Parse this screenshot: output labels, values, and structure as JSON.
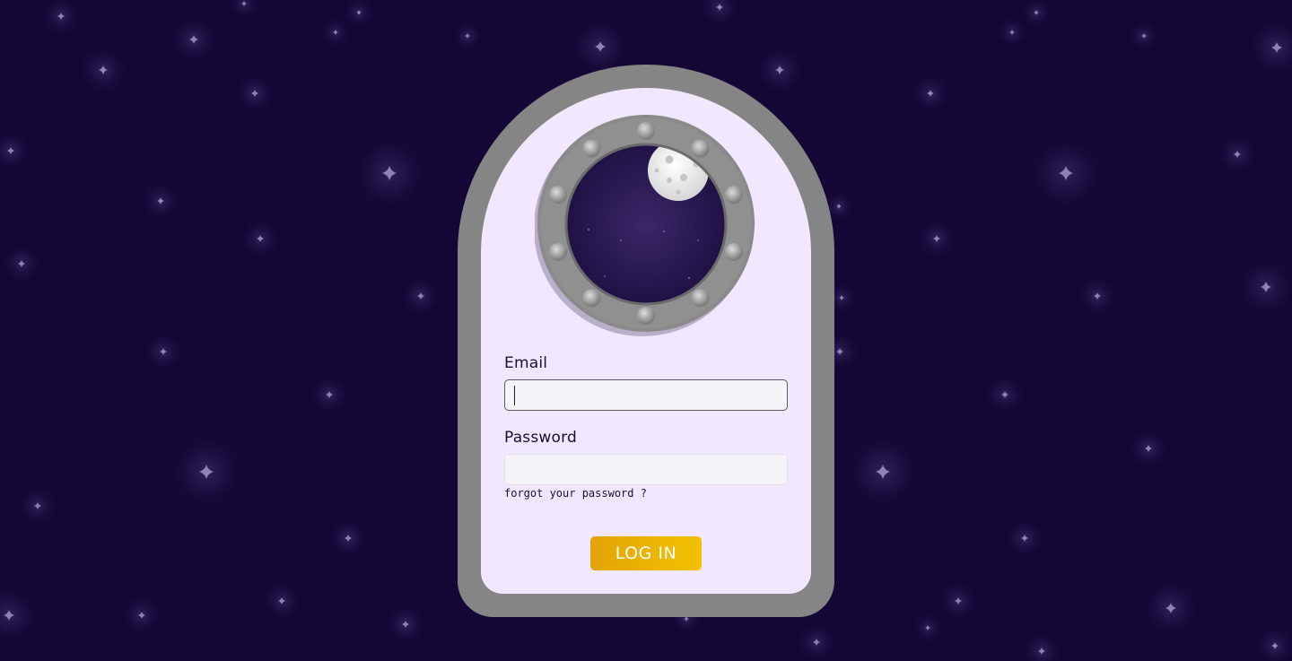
{
  "colors": {
    "background": "#140736",
    "door_frame": "#858585",
    "door_panel": "#f1e8ff",
    "accent": "#f2c100"
  },
  "icons": {
    "porthole": "porthole-window-icon",
    "moon": "moon-icon",
    "star": "four-point-star-icon"
  },
  "form": {
    "email_label": "Email",
    "email_value": "",
    "email_placeholder": "",
    "password_label": "Password",
    "password_value": "",
    "password_placeholder": "",
    "forgot_link": "forgot your password ?",
    "login_button": "LOG IN"
  }
}
